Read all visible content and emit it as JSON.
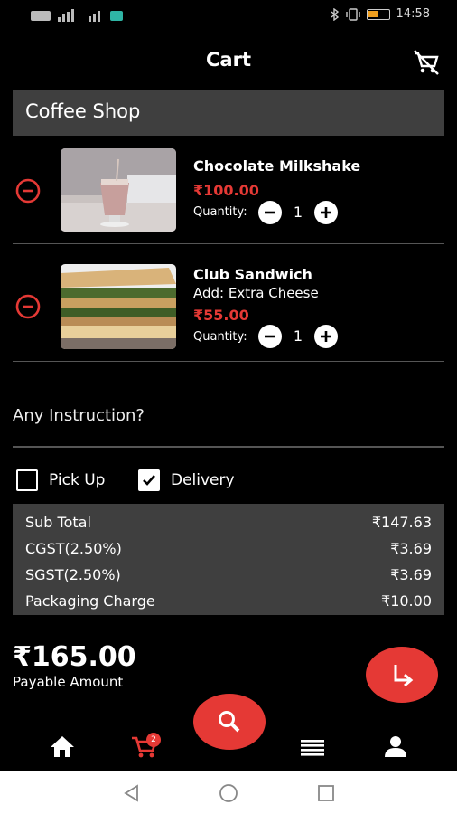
{
  "status_bar": {
    "time": "14:58"
  },
  "header": {
    "title": "Cart"
  },
  "shop": {
    "name": "Coffee Shop"
  },
  "items": [
    {
      "name": "Chocolate Milkshake",
      "addon": "",
      "price": "₹100.00",
      "quantity_label": "Quantity:",
      "quantity": "1"
    },
    {
      "name": "Club Sandwich",
      "addon": "Add: Extra Cheese",
      "price": "₹55.00",
      "quantity_label": "Quantity:",
      "quantity": "1"
    }
  ],
  "instruction": {
    "placeholder": "Any Instruction?"
  },
  "options": {
    "pickup_label": "Pick Up",
    "pickup_checked": false,
    "delivery_label": "Delivery",
    "delivery_checked": true
  },
  "summary": [
    {
      "label": "Sub Total",
      "value": "₹147.63"
    },
    {
      "label": "CGST(2.50%)",
      "value": "₹3.69"
    },
    {
      "label": "SGST(2.50%)",
      "value": "₹3.69"
    },
    {
      "label": "Packaging Charge",
      "value": "₹10.00"
    }
  ],
  "payable": {
    "amount": "₹165.00",
    "label": "Payable Amount"
  },
  "bottom_nav": {
    "cart_badge": "2"
  },
  "colors": {
    "accent": "#e53935",
    "panel": "#3f3f3f",
    "background": "#000000"
  },
  "icons": [
    "clear-cart-icon",
    "remove-item-icon",
    "minus-icon",
    "plus-icon",
    "checkbox-icon",
    "proceed-arrow-icon",
    "search-icon",
    "home-icon",
    "cart-icon",
    "menu-icon",
    "profile-icon",
    "back-icon",
    "home-circle-icon",
    "recents-icon"
  ]
}
